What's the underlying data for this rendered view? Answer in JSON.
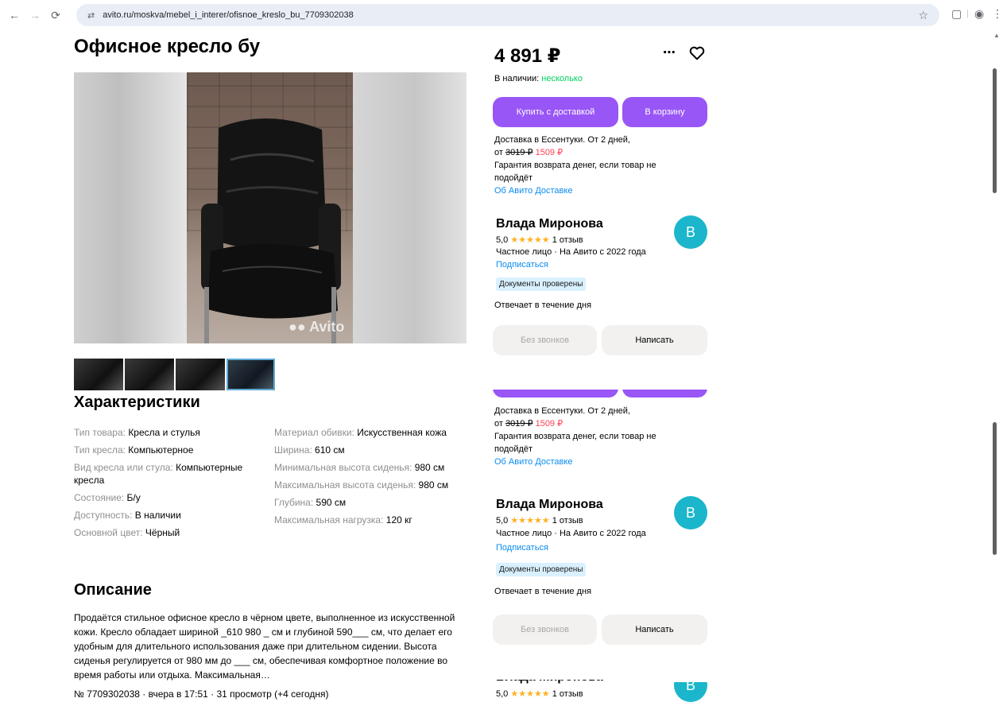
{
  "browser": {
    "url": "avito.ru/moskva/mebel_i_interer/ofisnoe_kreslo_bu_7709302038",
    "icons": [
      "back-icon",
      "forward-icon",
      "reload-icon",
      "site-settings-icon",
      "bookmark-star-icon",
      "extensions-icon",
      "profile-icon",
      "menu-icon"
    ]
  },
  "listing": {
    "title": "Офисное кресло бу",
    "watermark": "Avito",
    "thumbnails_count": 4,
    "active_thumbnail": 4
  },
  "specs": {
    "heading": "Характеристики",
    "left": [
      {
        "key": "Тип товара: ",
        "value": "Кресла и стулья"
      },
      {
        "key": "Тип кресла: ",
        "value": "Компьютерное"
      },
      {
        "key": "Вид кресла или стула: ",
        "value": "Компьютерные кресла"
      },
      {
        "key": "Состояние: ",
        "value": "Б/у"
      },
      {
        "key": "Доступность: ",
        "value": "В наличии"
      },
      {
        "key": "Основной цвет: ",
        "value": "Чёрный"
      }
    ],
    "right": [
      {
        "key": "Материал обивки: ",
        "value": "Искусственная кожа"
      },
      {
        "key": "Ширина: ",
        "value": "610 см"
      },
      {
        "key": "Минимальная высота сиденья: ",
        "value": "980 см"
      },
      {
        "key": "Максимальная высота сиденья: ",
        "value": "980 см"
      },
      {
        "key": "Глубина: ",
        "value": "590 см"
      },
      {
        "key": "Максимальная нагрузка: ",
        "value": "120 кг"
      }
    ]
  },
  "description": {
    "heading": "Описание",
    "text": "Продаётся стильное офисное кресло в чёрном цвете, выполненное из искусственной кожи. Кресло обладает шириной _610 980 _ см и глубиной 590___ см, что делает его удобным для длительного использования даже при длительном сидении. Высота сиденья регулируется от 980 мм до ___ см, обеспечивая комфортное положение во время работы или отдыха. Максимальная…",
    "meta": "№ 7709302038 · вчера в 17:51 · 31 просмотр (+4 сегодня)"
  },
  "purchase": {
    "price": "4 891 ₽",
    "availability_label": "В наличии: ",
    "availability_value": "несколько",
    "buy_label": "Купить с доставкой",
    "cart_label": "В корзину",
    "delivery_line1": "Доставка в Ессентуки. От 2 дней,",
    "delivery_from": "от ",
    "delivery_old": "3019 ₽",
    "delivery_new": "1509 ₽",
    "guarantee": "Гарантия возврата денег, если товар не подойдёт",
    "about_link": "Об Авито Доставке"
  },
  "seller": {
    "name": "Влада Миронова",
    "rating": "5,0",
    "stars": "★★★★★",
    "reviews": "1 отзыв",
    "type_line": "Частное лицо · На Авито с 2022 года",
    "subscribe": "Подписаться",
    "badge": "Документы проверены",
    "answers": "Отвечает в течение дня",
    "no_calls_label": "Без звонков",
    "write_label": "Написать",
    "avatar_letter": "В"
  },
  "colors": {
    "accent_purple": "#9956f6",
    "link_blue": "#0a8cf0",
    "green": "#02d15c",
    "red": "#ff4053",
    "avatar": "#1bb6cb",
    "star": "#ffb021"
  }
}
